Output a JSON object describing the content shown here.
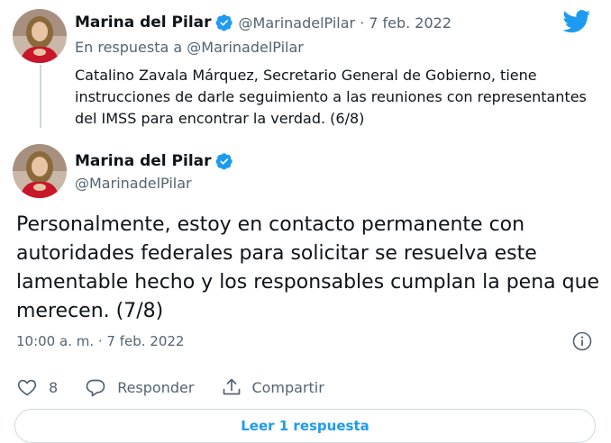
{
  "reply_tweet": {
    "author_name": "Marina del Pilar",
    "handle": "@MarinadelPilar",
    "separator": "·",
    "date": "7 feb. 2022",
    "reply_to_prefix": "En respuesta a",
    "reply_to_handle": "@MarinadelPilar",
    "text": "Catalino Zavala Márquez, Secretario General de Gobierno, tiene instrucciones de darle seguimiento a las reuniones con representantes del IMSS para encontrar la verdad. (6/8)"
  },
  "main_tweet": {
    "author_name": "Marina del Pilar",
    "handle": "@MarinadelPilar",
    "text": "Personalmente, estoy en contacto permanente con autoridades federales para solicitar se resuelva este lamentable hecho y los responsables cumplan la pena que merecen. (7/8)",
    "timestamp": "10:00 a. m. · 7 feb. 2022"
  },
  "actions": {
    "like_count": "8",
    "reply_label": "Responder",
    "share_label": "Compartir"
  },
  "read_replies_label": "Leer 1 respuesta",
  "icons": {
    "brand": "twitter-bird-icon",
    "verified": "verified-badge-icon",
    "info": "info-icon",
    "like": "heart-icon",
    "reply": "reply-bubble-icon",
    "share": "share-icon"
  },
  "colors": {
    "accent": "#1d9bf0",
    "text": "#0f1419",
    "secondary": "#536471",
    "border": "#cfd9de"
  }
}
